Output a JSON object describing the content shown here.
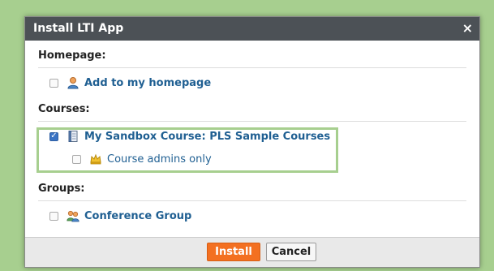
{
  "window": {
    "title": "Install LTI App",
    "close_glyph": "×"
  },
  "homepage": {
    "heading": "Homepage:",
    "items": [
      {
        "label": "Add to my homepage",
        "icon": "person-icon",
        "checked": false
      }
    ]
  },
  "courses": {
    "heading": "Courses:",
    "items": [
      {
        "label": "My Sandbox Course: PLS Sample Courses",
        "icon": "notebook-icon",
        "checked": true
      },
      {
        "label": "Course admins only",
        "icon": "crown-icon",
        "checked": false
      }
    ]
  },
  "groups": {
    "heading": "Groups:",
    "items": [
      {
        "label": "Conference Group",
        "icon": "people-icon",
        "checked": false
      }
    ]
  },
  "footer": {
    "install_label": "Install",
    "cancel_label": "Cancel"
  },
  "colors": {
    "accent_install": "#f37021",
    "link": "#1f5f92",
    "highlight_border": "#a7cf8f",
    "titlebar": "#4c5156",
    "checked_box": "#3a73c4"
  }
}
